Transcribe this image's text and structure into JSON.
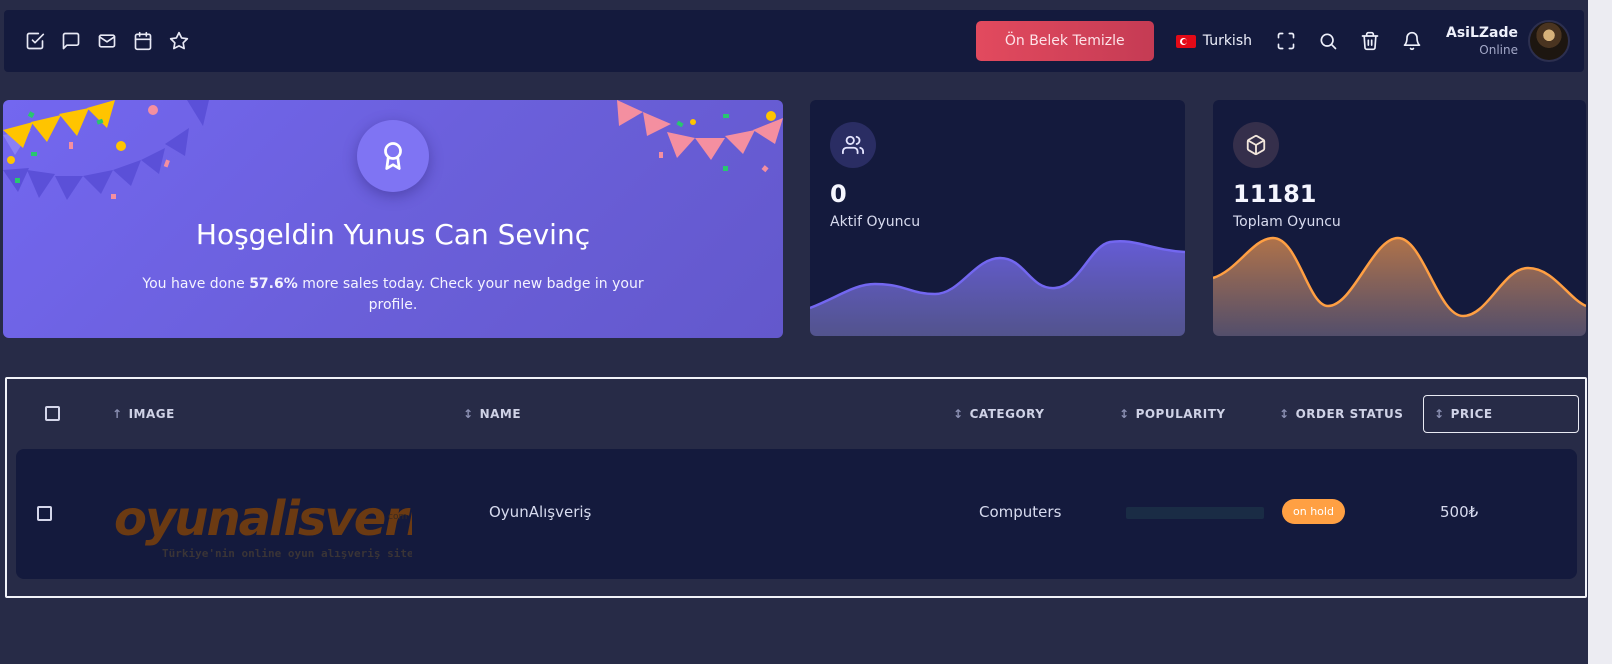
{
  "navbar": {
    "left_icons": [
      "checkbox-icon",
      "message-icon",
      "mail-icon",
      "calendar-icon",
      "star-icon"
    ],
    "clear_cache_label": "Ön Belek Temizle",
    "language": "Turkish",
    "user": {
      "name": "AsiLZade",
      "status": "Online"
    }
  },
  "welcome": {
    "title": "Hoşgeldin Yunus Can Sevinç",
    "text_before": "You have done ",
    "highlight": "57.6%",
    "text_after": " more sales today. Check your new badge in your profile."
  },
  "stats": [
    {
      "value": "0",
      "label": "Aktif Oyuncu",
      "icon": "users-icon",
      "color": "#7367f0"
    },
    {
      "value": "11181",
      "label": "Toplam Oyuncu",
      "icon": "box-icon",
      "color": "#ff9f43"
    }
  ],
  "table": {
    "columns": {
      "image": "IMAGE",
      "name": "NAME",
      "category": "CATEGORY",
      "popularity": "POPULARITY",
      "order_status": "ORDER STATUS",
      "price": "PRICE"
    },
    "rows": [
      {
        "logo_text": "oyunalisveris",
        "logo_suffix": "com",
        "logo_tagline": "Türkiye'nin online oyun alışveriş sitesi",
        "name": "OyunAlışveriş",
        "category": "Computers",
        "popularity": 0,
        "status": "on hold",
        "price": "500₺"
      }
    ]
  },
  "colors": {
    "accent": "#7367f0",
    "warning": "#ff9f43",
    "danger": "#ea5455",
    "navbar": "#141a3d",
    "background": "#272b47"
  }
}
